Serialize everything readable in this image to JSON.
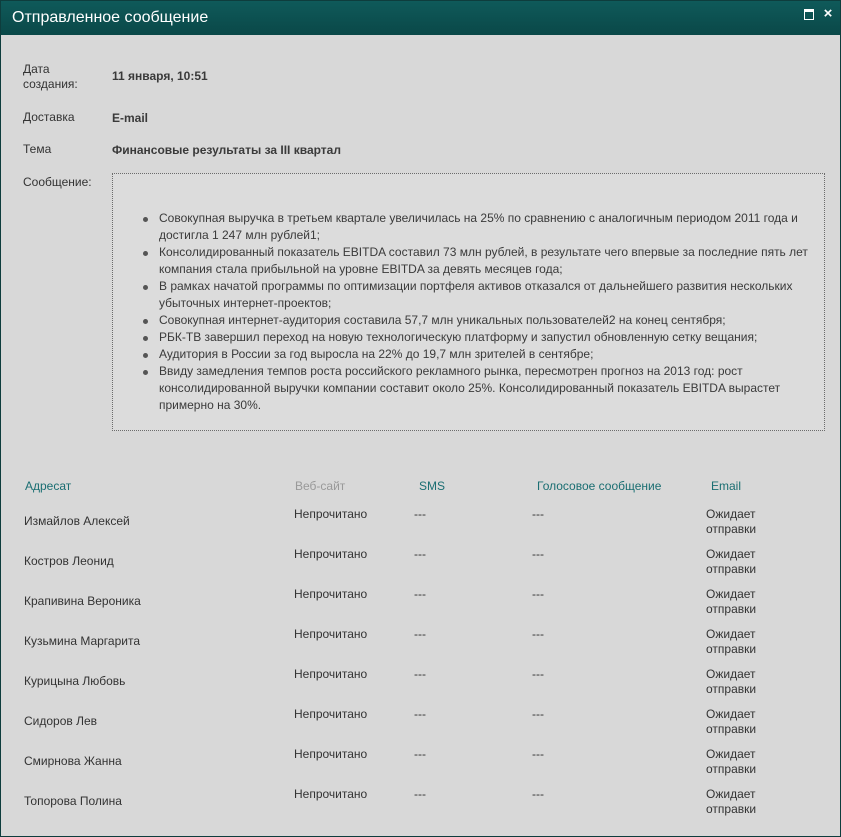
{
  "window": {
    "title": "Отправленное сообщение",
    "maximize_icon": "maximize-icon",
    "close_label": "×"
  },
  "fields": {
    "created_label": "Дата создания:",
    "created_value": "11 января, 10:51",
    "delivery_label": "Доставка",
    "delivery_value": "E-mail",
    "subject_label": "Тема",
    "subject_value": "Финансовые результаты за III квартал",
    "message_label": "Сообщение:"
  },
  "message": {
    "items": [
      "Совокупная выручка в третьем квартале увеличилась на 25% по сравнению с аналогичным периодом 2011 года и достигла 1 247 млн рублей1;",
      "Консолидированный показатель EBITDA составил 73 млн рублей, в результате чего впервые за последние пять лет компания стала прибыльной на уровне EBITDA за девять месяцев года;",
      "В рамках начатой программы по оптимизации портфеля активов отказался от дальнейшего развития нескольких убыточных интернет-проектов;",
      "Совокупная интернет-аудитория составила 57,7 млн уникальных пользователей2 на конец сентября;",
      "РБК-ТВ завершил переход на новую технологическую платформу и запустил обновленную сетку вещания;",
      "Аудитория в России за год выросла на 22% до 19,7 млн зрителей в сентябре;",
      "Ввиду замедления темпов роста российского рекламного рынка, пересмотрен прогноз на 2013 год: рост консолидированной выручки компании составит около 25%. Консолидированный показатель EBITDA вырастет примерно на 30%."
    ]
  },
  "table": {
    "headers": {
      "recipient": "Адресат",
      "website": "Веб-сайт",
      "sms": "SMS",
      "voice": "Голосовое сообщение",
      "email": "Email"
    },
    "rows": [
      {
        "name": "Измайлов Алексей",
        "website": "Непрочитано",
        "sms": "---",
        "voice": "---",
        "email": "Ожидает отправки"
      },
      {
        "name": "Костров Леонид",
        "website": "Непрочитано",
        "sms": "---",
        "voice": "---",
        "email": "Ожидает отправки"
      },
      {
        "name": "Крапивина Вероника",
        "website": "Непрочитано",
        "sms": "---",
        "voice": "---",
        "email": "Ожидает отправки"
      },
      {
        "name": "Кузьмина Маргарита",
        "website": "Непрочитано",
        "sms": "---",
        "voice": "---",
        "email": "Ожидает отправки"
      },
      {
        "name": "Курицына Любовь",
        "website": "Непрочитано",
        "sms": "---",
        "voice": "---",
        "email": "Ожидает отправки"
      },
      {
        "name": "Сидоров Лев",
        "website": "Непрочитано",
        "sms": "---",
        "voice": "---",
        "email": "Ожидает отправки"
      },
      {
        "name": "Смирнова Жанна",
        "website": "Непрочитано",
        "sms": "---",
        "voice": "---",
        "email": "Ожидает отправки"
      },
      {
        "name": "Топорова Полина",
        "website": "Непрочитано",
        "sms": "---",
        "voice": "---",
        "email": "Ожидает отправки"
      }
    ]
  }
}
